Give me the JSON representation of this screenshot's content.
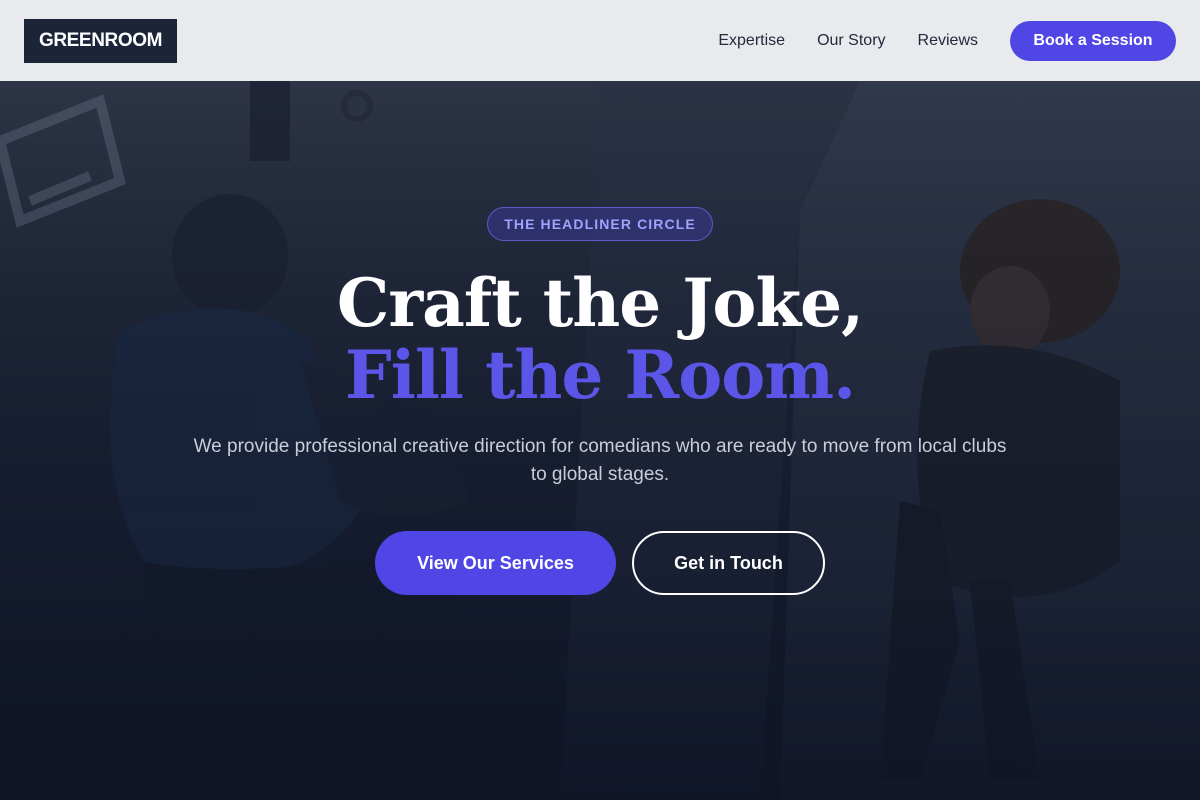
{
  "header": {
    "logo": "GREENROOM",
    "nav": [
      {
        "label": "Expertise"
      },
      {
        "label": "Our Story"
      },
      {
        "label": "Reviews"
      }
    ],
    "cta_label": "Book a Session"
  },
  "hero": {
    "badge": "THE HEADLINER CIRCLE",
    "headline_line1": "Craft the Joke,",
    "headline_line2": "Fill the Room.",
    "subtext": "We provide professional creative direction for comedians who are ready to move from local clubs to global stages.",
    "primary_button": "View Our Services",
    "secondary_button": "Get in Touch",
    "background_image": "performers-overhead-photo"
  },
  "colors": {
    "accent": "#4f46e5",
    "header_bg": "#e9eaed",
    "logo_bg": "#1c2538",
    "hero_dark": "#111729",
    "headline_accent": "#5b55e8"
  }
}
